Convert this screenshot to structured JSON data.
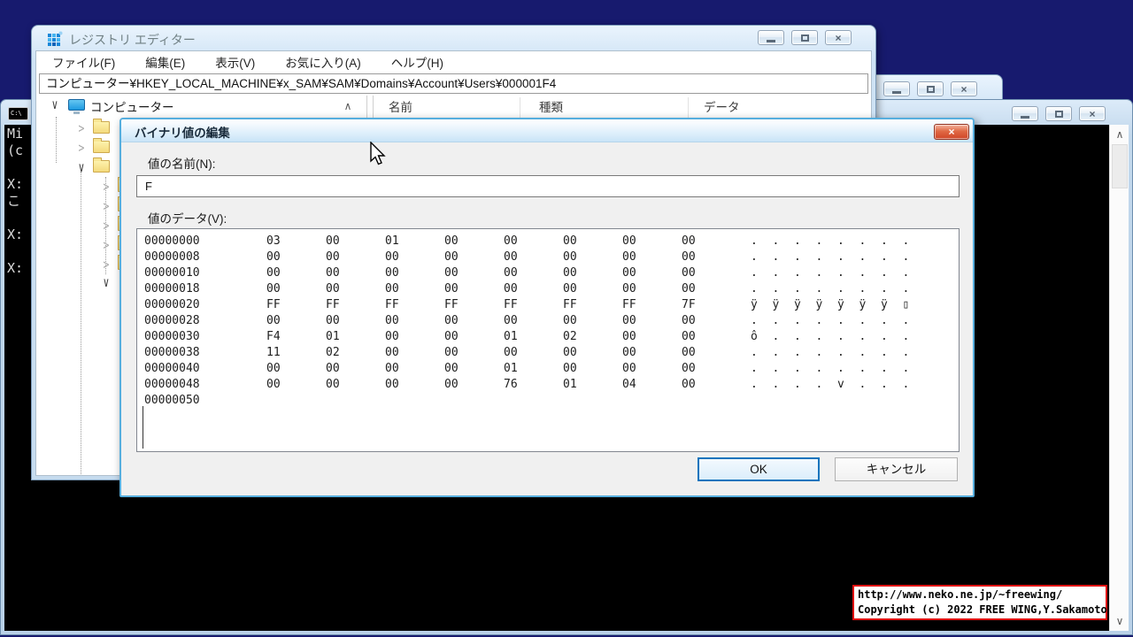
{
  "regedit": {
    "title": "レジストリ エディター",
    "menus": [
      "ファイル(F)",
      "編集(E)",
      "表示(V)",
      "お気に入り(A)",
      "ヘルプ(H)"
    ],
    "address": "コンピューター¥HKEY_LOCAL_MACHINE¥x_SAM¥SAM¥Domains¥Account¥Users¥000001F4",
    "tree_root_label": "コンピューター",
    "list_columns": [
      "名前",
      "種類",
      "データ"
    ]
  },
  "dialog": {
    "title": "バイナリ値の編集",
    "name_label": "値の名前(N):",
    "name_value": "F",
    "data_label": "値のデータ(V):",
    "ok_label": "OK",
    "cancel_label": "キャンセル",
    "hex_rows": [
      {
        "addr": "00000000",
        "bytes": [
          "03",
          "00",
          "01",
          "00",
          "00",
          "00",
          "00",
          "00"
        ],
        "ascii": [
          ".",
          ".",
          ".",
          ".",
          ".",
          ".",
          ".",
          "."
        ]
      },
      {
        "addr": "00000008",
        "bytes": [
          "00",
          "00",
          "00",
          "00",
          "00",
          "00",
          "00",
          "00"
        ],
        "ascii": [
          ".",
          ".",
          ".",
          ".",
          ".",
          ".",
          ".",
          "."
        ]
      },
      {
        "addr": "00000010",
        "bytes": [
          "00",
          "00",
          "00",
          "00",
          "00",
          "00",
          "00",
          "00"
        ],
        "ascii": [
          ".",
          ".",
          ".",
          ".",
          ".",
          ".",
          ".",
          "."
        ]
      },
      {
        "addr": "00000018",
        "bytes": [
          "00",
          "00",
          "00",
          "00",
          "00",
          "00",
          "00",
          "00"
        ],
        "ascii": [
          ".",
          ".",
          ".",
          ".",
          ".",
          ".",
          ".",
          "."
        ]
      },
      {
        "addr": "00000020",
        "bytes": [
          "FF",
          "FF",
          "FF",
          "FF",
          "FF",
          "FF",
          "FF",
          "7F"
        ],
        "ascii": [
          "ÿ",
          "ÿ",
          "ÿ",
          "ÿ",
          "ÿ",
          "ÿ",
          "ÿ",
          "▯"
        ]
      },
      {
        "addr": "00000028",
        "bytes": [
          "00",
          "00",
          "00",
          "00",
          "00",
          "00",
          "00",
          "00"
        ],
        "ascii": [
          ".",
          ".",
          ".",
          ".",
          ".",
          ".",
          ".",
          "."
        ]
      },
      {
        "addr": "00000030",
        "bytes": [
          "F4",
          "01",
          "00",
          "00",
          "01",
          "02",
          "00",
          "00"
        ],
        "ascii": [
          "ô",
          ".",
          ".",
          ".",
          ".",
          ".",
          ".",
          "."
        ]
      },
      {
        "addr": "00000038",
        "bytes": [
          "11",
          "02",
          "00",
          "00",
          "00",
          "00",
          "00",
          "00"
        ],
        "ascii": [
          ".",
          ".",
          ".",
          ".",
          ".",
          ".",
          ".",
          "."
        ]
      },
      {
        "addr": "00000040",
        "bytes": [
          "00",
          "00",
          "00",
          "00",
          "01",
          "00",
          "00",
          "00"
        ],
        "ascii": [
          ".",
          ".",
          ".",
          ".",
          ".",
          ".",
          ".",
          "."
        ]
      },
      {
        "addr": "00000048",
        "bytes": [
          "00",
          "00",
          "00",
          "00",
          "76",
          "01",
          "04",
          "00"
        ],
        "ascii": [
          ".",
          ".",
          ".",
          ".",
          "v",
          ".",
          ".",
          "."
        ]
      },
      {
        "addr": "00000050",
        "bytes": [],
        "ascii": []
      }
    ]
  },
  "cmd": {
    "icon_label": "C:\\",
    "lines": [
      "Mi",
      "(c",
      "",
      "X:",
      "こ",
      "",
      "X:",
      "",
      "X:"
    ]
  },
  "watermark": {
    "line1": "http://www.neko.ne.jp/~freewing/",
    "line2": "Copyright (c) 2022 FREE WING,Y.Sakamoto"
  },
  "colors": {
    "desktop": "#171a6e",
    "accent_blue": "#0f74bd",
    "dialog_border": "#56aede",
    "close_red": "#cf4526",
    "watermark_border": "#e01010",
    "folder_yellow": "#f4da7d"
  }
}
